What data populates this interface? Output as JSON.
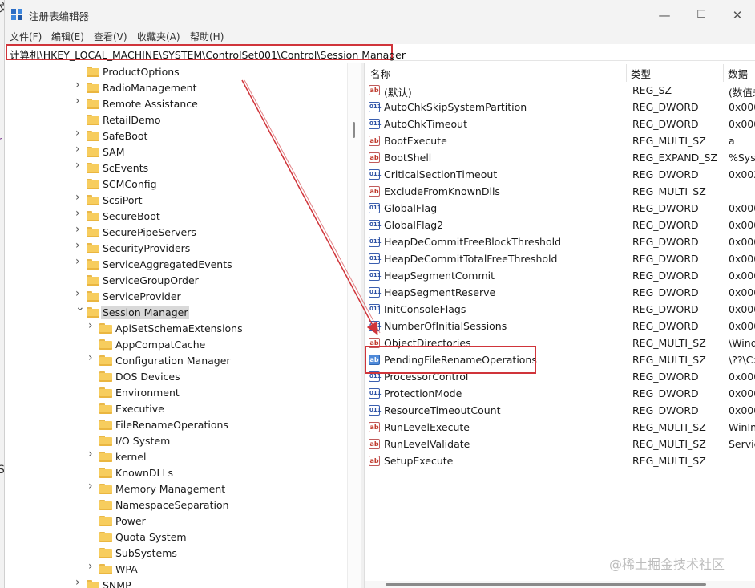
{
  "window": {
    "title": "注册表编辑器",
    "controls": {
      "minimize": "—",
      "maximize": "☐",
      "close": "✕"
    }
  },
  "menu": [
    "文件(F)",
    "编辑(E)",
    "查看(V)",
    "收藏夹(A)",
    "帮助(H)"
  ],
  "address": "计算机\\HKEY_LOCAL_MACHINE\\SYSTEM\\ControlSet001\\Control\\Session Manager",
  "tree": {
    "items": [
      {
        "label": "ProductOptions",
        "level": 0,
        "expander": "none"
      },
      {
        "label": "RadioManagement",
        "level": 0,
        "expander": "collapsed"
      },
      {
        "label": "Remote Assistance",
        "level": 0,
        "expander": "collapsed"
      },
      {
        "label": "RetailDemo",
        "level": 0,
        "expander": "none"
      },
      {
        "label": "SafeBoot",
        "level": 0,
        "expander": "collapsed"
      },
      {
        "label": "SAM",
        "level": 0,
        "expander": "collapsed"
      },
      {
        "label": "ScEvents",
        "level": 0,
        "expander": "collapsed"
      },
      {
        "label": "SCMConfig",
        "level": 0,
        "expander": "none"
      },
      {
        "label": "ScsiPort",
        "level": 0,
        "expander": "collapsed"
      },
      {
        "label": "SecureBoot",
        "level": 0,
        "expander": "collapsed"
      },
      {
        "label": "SecurePipeServers",
        "level": 0,
        "expander": "collapsed"
      },
      {
        "label": "SecurityProviders",
        "level": 0,
        "expander": "collapsed"
      },
      {
        "label": "ServiceAggregatedEvents",
        "level": 0,
        "expander": "collapsed"
      },
      {
        "label": "ServiceGroupOrder",
        "level": 0,
        "expander": "none"
      },
      {
        "label": "ServiceProvider",
        "level": 0,
        "expander": "collapsed"
      },
      {
        "label": "Session Manager",
        "level": 0,
        "expander": "expanded",
        "selected": true
      },
      {
        "label": "ApiSetSchemaExtensions",
        "level": 1,
        "expander": "collapsed"
      },
      {
        "label": "AppCompatCache",
        "level": 1,
        "expander": "none"
      },
      {
        "label": "Configuration Manager",
        "level": 1,
        "expander": "collapsed"
      },
      {
        "label": "DOS Devices",
        "level": 1,
        "expander": "none"
      },
      {
        "label": "Environment",
        "level": 1,
        "expander": "none"
      },
      {
        "label": "Executive",
        "level": 1,
        "expander": "none"
      },
      {
        "label": "FileRenameOperations",
        "level": 1,
        "expander": "none"
      },
      {
        "label": "I/O System",
        "level": 1,
        "expander": "none"
      },
      {
        "label": "kernel",
        "level": 1,
        "expander": "collapsed"
      },
      {
        "label": "KnownDLLs",
        "level": 1,
        "expander": "none"
      },
      {
        "label": "Memory Management",
        "level": 1,
        "expander": "collapsed"
      },
      {
        "label": "NamespaceSeparation",
        "level": 1,
        "expander": "none"
      },
      {
        "label": "Power",
        "level": 1,
        "expander": "none"
      },
      {
        "label": "Quota System",
        "level": 1,
        "expander": "none"
      },
      {
        "label": "SubSystems",
        "level": 1,
        "expander": "none"
      },
      {
        "label": "WPA",
        "level": 1,
        "expander": "collapsed"
      },
      {
        "label": "SNMP",
        "level": 0,
        "expander": "collapsed"
      }
    ]
  },
  "values": {
    "headers": {
      "name": "名称",
      "type": "类型",
      "data": "数据"
    },
    "rows": [
      {
        "name": "(默认)",
        "type": "REG_SZ",
        "data": "(数值未",
        "icon": "string"
      },
      {
        "name": "AutoChkSkipSystemPartition",
        "type": "REG_DWORD",
        "data": "0x000",
        "icon": "dword"
      },
      {
        "name": "AutoChkTimeout",
        "type": "REG_DWORD",
        "data": "0x000",
        "icon": "dword"
      },
      {
        "name": "BootExecute",
        "type": "REG_MULTI_SZ",
        "data": "a",
        "icon": "string"
      },
      {
        "name": "BootShell",
        "type": "REG_EXPAND_SZ",
        "data": "%Syst",
        "icon": "string"
      },
      {
        "name": "CriticalSectionTimeout",
        "type": "REG_DWORD",
        "data": "0x002",
        "icon": "dword"
      },
      {
        "name": "ExcludeFromKnownDlls",
        "type": "REG_MULTI_SZ",
        "data": "",
        "icon": "string"
      },
      {
        "name": "GlobalFlag",
        "type": "REG_DWORD",
        "data": "0x000",
        "icon": "dword"
      },
      {
        "name": "GlobalFlag2",
        "type": "REG_DWORD",
        "data": "0x000",
        "icon": "dword"
      },
      {
        "name": "HeapDeCommitFreeBlockThreshold",
        "type": "REG_DWORD",
        "data": "0x000",
        "icon": "dword"
      },
      {
        "name": "HeapDeCommitTotalFreeThreshold",
        "type": "REG_DWORD",
        "data": "0x000",
        "icon": "dword"
      },
      {
        "name": "HeapSegmentCommit",
        "type": "REG_DWORD",
        "data": "0x000",
        "icon": "dword"
      },
      {
        "name": "HeapSegmentReserve",
        "type": "REG_DWORD",
        "data": "0x000",
        "icon": "dword"
      },
      {
        "name": "InitConsoleFlags",
        "type": "REG_DWORD",
        "data": "0x000",
        "icon": "dword"
      },
      {
        "name": "NumberOfInitialSessions",
        "type": "REG_DWORD",
        "data": "0x000",
        "icon": "dword"
      },
      {
        "name": "ObjectDirectories",
        "type": "REG_MULTI_SZ",
        "data": "\\Wind",
        "icon": "string"
      },
      {
        "name": "PendingFileRenameOperations",
        "type": "REG_MULTI_SZ",
        "data": "\\??\\C:",
        "icon": "string",
        "selected": true
      },
      {
        "name": "ProcessorControl",
        "type": "REG_DWORD",
        "data": "0x000",
        "icon": "dword"
      },
      {
        "name": "ProtectionMode",
        "type": "REG_DWORD",
        "data": "0x000",
        "icon": "dword"
      },
      {
        "name": "ResourceTimeoutCount",
        "type": "REG_DWORD",
        "data": "0x000",
        "icon": "dword"
      },
      {
        "name": "RunLevelExecute",
        "type": "REG_MULTI_SZ",
        "data": "WinIn",
        "icon": "string"
      },
      {
        "name": "RunLevelValidate",
        "type": "REG_MULTI_SZ",
        "data": "Servic",
        "icon": "string"
      },
      {
        "name": "SetupExecute",
        "type": "REG_MULTI_SZ",
        "data": "",
        "icon": "string"
      }
    ]
  },
  "icons": {
    "string": "ab",
    "dword": "011"
  },
  "annotation": {
    "color": "#d0343a"
  },
  "watermark": "@稀土掘金技术社区",
  "background_glyphs": [
    "文",
    "r",
    "S"
  ]
}
